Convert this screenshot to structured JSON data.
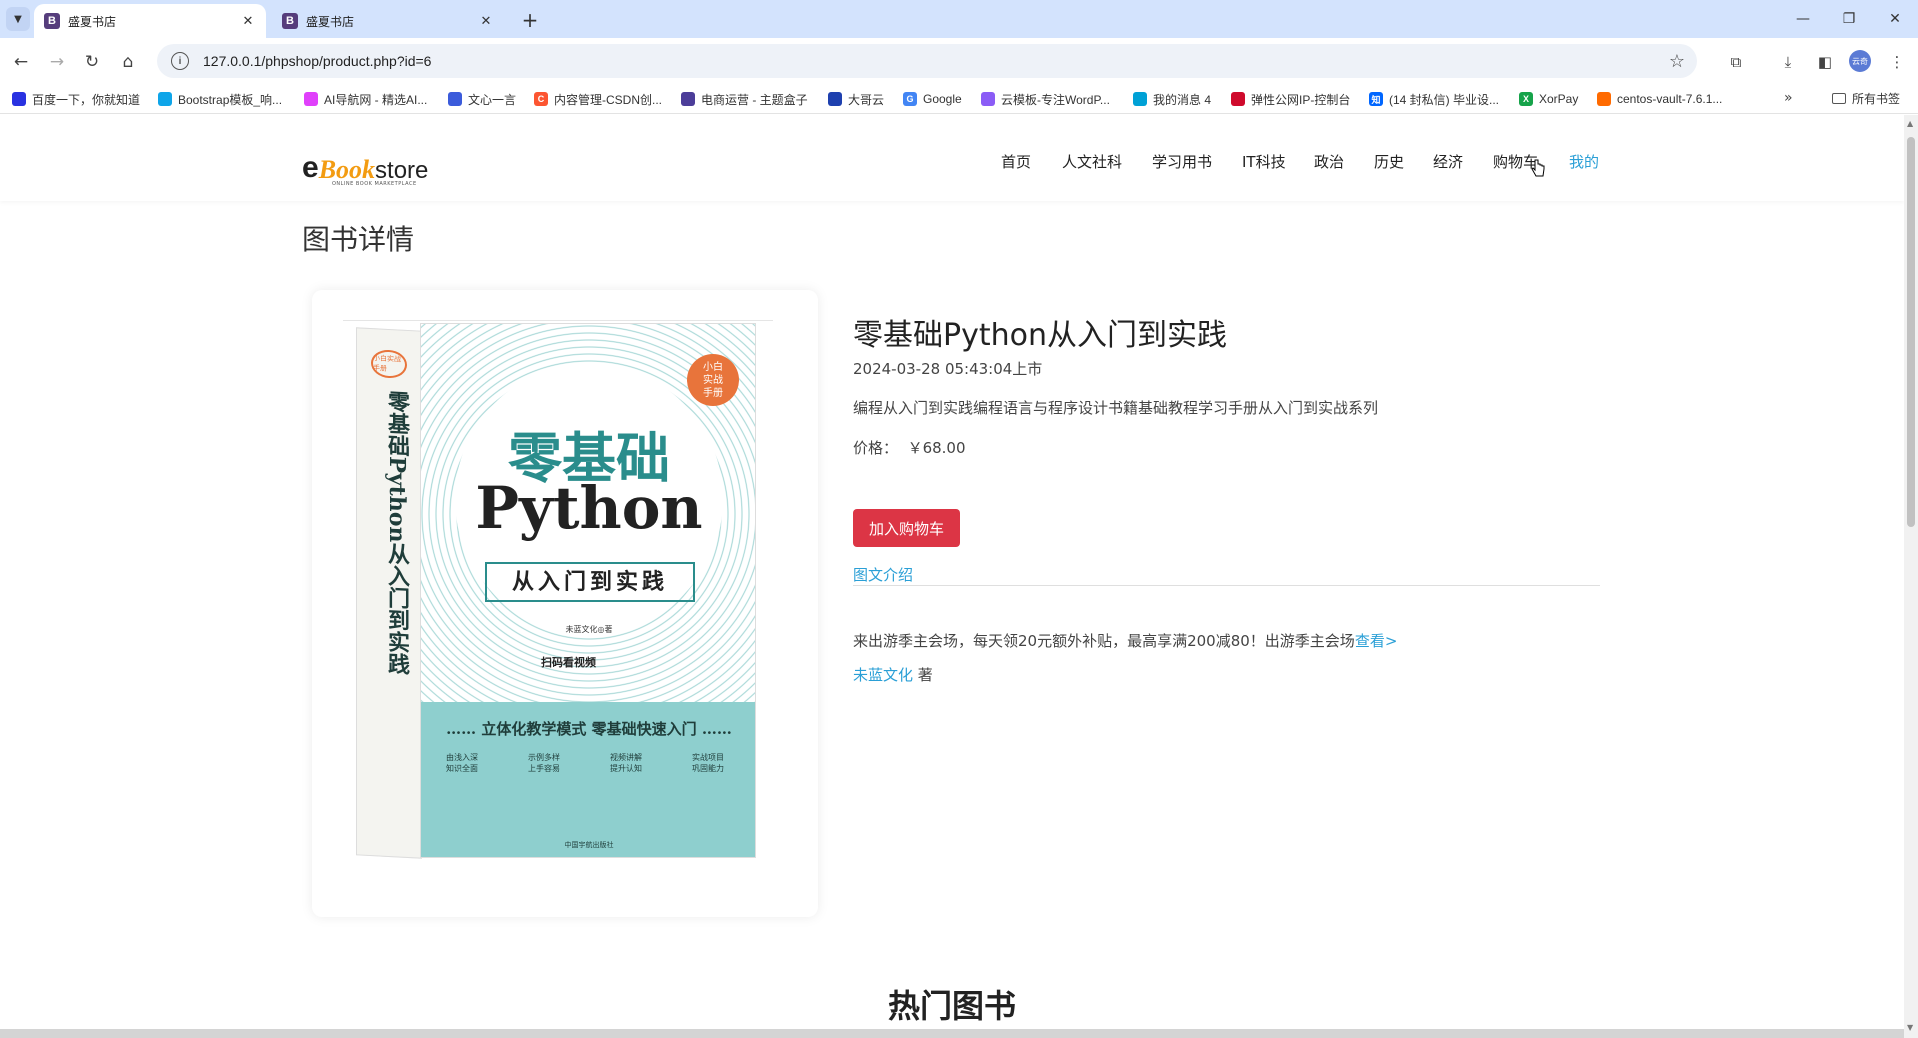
{
  "browser": {
    "tabs": [
      {
        "title": "盛夏书店",
        "active": true
      },
      {
        "title": "盛夏书店",
        "active": false
      }
    ],
    "favicon_letter": "B",
    "url": "127.0.0.1/phpshop/product.php?id=6",
    "profile_label": "云奇",
    "bookmarks": [
      {
        "label": "百度一下，你就知道",
        "color": "#2932e1"
      },
      {
        "label": "Bootstrap模板_响...",
        "color": "#0ea5e9"
      },
      {
        "label": "AI导航网 - 精选AI...",
        "color": "#e040fb"
      },
      {
        "label": "文心一言",
        "color": "#3b5bdb"
      },
      {
        "label": "内容管理-CSDN创...",
        "color": "#fc5531"
      },
      {
        "label": "电商运营 - 主题盒子",
        "color": "#4c3d99"
      },
      {
        "label": "大哥云",
        "color": "#1e40af"
      },
      {
        "label": "Google",
        "color": "#4285f4"
      },
      {
        "label": "云模板-专注WordP...",
        "color": "#8b5cf6"
      },
      {
        "label": "我的消息 4",
        "color": "#00a1d6"
      },
      {
        "label": "弹性公网IP-控制台",
        "color": "#cf0a2c"
      },
      {
        "label": "(14 封私信) 毕业设...",
        "color": "#0066ff"
      },
      {
        "label": "XorPay",
        "color": "#16a34a"
      },
      {
        "label": "centos-vault-7.6.1...",
        "color": "#ff6a00"
      }
    ],
    "all_bookmarks_label": "所有书签"
  },
  "site": {
    "logo": {
      "e": "e",
      "book": "Book",
      "store": "store",
      "tagline": "ONLINE BOOK MARKETPLACE"
    },
    "nav": [
      "首页",
      "人文社科",
      "学习用书",
      "IT科技",
      "政治",
      "历史",
      "经济",
      "购物车",
      "我的"
    ],
    "page_title": "图书详情"
  },
  "product": {
    "title": "零基础Python从入门到实践",
    "date": "2024-03-28 05:43:04上市",
    "description": "编程从入门到实践编程语言与程序设计书籍基础教程学习手册从入门到实战系列",
    "price_label": "价格：",
    "price": "￥68.00",
    "add_to_cart": "加入购物车",
    "intro_tab": "图文介绍",
    "promo_text": "来出游季主会场，每天领20元额外补贴，最高享满200减80！出游季主会场",
    "promo_link": "查看>",
    "author": "未蓝文化",
    "author_suffix": " 著"
  },
  "cover": {
    "badge": "小白\n实战\n手册",
    "title_cn": "零基础",
    "title_en": "Python",
    "subtitle": "从入门到实践",
    "author": "未蓝文化◎著",
    "scan": "扫码看视频",
    "band_title": "……  立体化教学模式  零基础快速入门  ……",
    "band_cols": [
      "由浅入深\n知识全面",
      "示例多样\n上手容易",
      "视频讲解\n提升认知",
      "实战项目\n巩固能力"
    ],
    "publisher": "中国宇航出版社",
    "spine_text": "零基础Python从入门到实践",
    "spine_badge": "小白实战手册"
  },
  "section": {
    "hot_books": "热门图书"
  }
}
